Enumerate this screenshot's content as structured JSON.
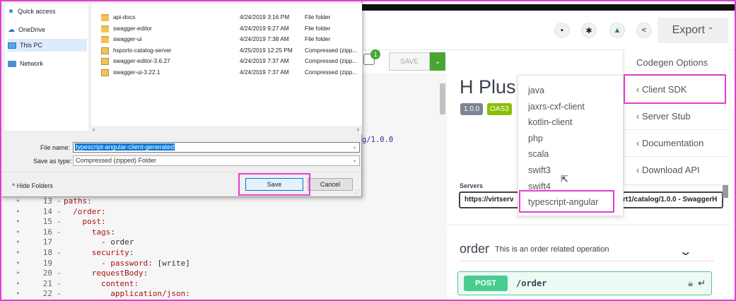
{
  "header": {
    "export_label": "Export",
    "icons": [
      "file-icon",
      "gear-icon",
      "bell-icon",
      "share-icon"
    ]
  },
  "editor": {
    "save_label": "SAVE",
    "notification_count": "1",
    "version_fragment": "g/1.0.0",
    "lines": [
      {
        "num": "13",
        "fold": "-",
        "key": "paths:",
        "rest": ""
      },
      {
        "num": "14",
        "fold": "-",
        "key": "  /order:",
        "rest": ""
      },
      {
        "num": "15",
        "fold": "-",
        "key": "    post:",
        "rest": ""
      },
      {
        "num": "16",
        "fold": "-",
        "key": "      tags:",
        "rest": ""
      },
      {
        "num": "17",
        "fold": "",
        "key": "",
        "rest": "        - order"
      },
      {
        "num": "18",
        "fold": "-",
        "key": "      security:",
        "rest": ""
      },
      {
        "num": "19",
        "fold": "",
        "key": "        - password:",
        "rest": " [write]"
      },
      {
        "num": "20",
        "fold": "-",
        "key": "      requestBody:",
        "rest": ""
      },
      {
        "num": "21",
        "fold": "-",
        "key": "        content:",
        "rest": ""
      },
      {
        "num": "22",
        "fold": "-",
        "key": "          application/json:",
        "rest": ""
      }
    ]
  },
  "api": {
    "title": "H Plus",
    "version": "1.0.0",
    "oas": "OAS3",
    "servers_label": "Servers",
    "server_url_prefix": "https://virtserv",
    "server_url_suffix": "rt1/catalog/1.0.0 - SwaggerH",
    "tag_name": "order",
    "tag_description": "This is an order related operation",
    "op_method": "POST",
    "op_path": "/order"
  },
  "export_menu": {
    "items": [
      "Codegen Options",
      "‹ Client SDK",
      "‹ Server Stub",
      "‹ Documentation",
      "‹ Download API"
    ]
  },
  "language_menu": {
    "items": [
      "java",
      "jaxrs-cxf-client",
      "kotlin-client",
      "php",
      "scala",
      "swift3",
      "swift4",
      "typescript-angular"
    ]
  },
  "dialog": {
    "nav": [
      {
        "label": "Quick access",
        "icon": "star-icon"
      },
      {
        "label": "OneDrive",
        "icon": "cloud-icon"
      },
      {
        "label": "This PC",
        "icon": "monitor-icon"
      },
      {
        "label": "Network",
        "icon": "network-icon"
      }
    ],
    "files": [
      {
        "name": "api-docs",
        "date": "4/24/2019 3:16 PM",
        "type": "File folder",
        "kind": "folder"
      },
      {
        "name": "swagger-editor",
        "date": "4/24/2019 9:27 AM",
        "type": "File folder",
        "kind": "folder"
      },
      {
        "name": "swagger-ui",
        "date": "4/24/2019 7:38 AM",
        "type": "File folder",
        "kind": "folder"
      },
      {
        "name": "hsports-catalog-server",
        "date": "4/25/2019 12:25 PM",
        "type": "Compressed (zipp...",
        "kind": "zip"
      },
      {
        "name": "swagger-editor-3.6.27",
        "date": "4/24/2019 7:37 AM",
        "type": "Compressed (zipp...",
        "kind": "zip"
      },
      {
        "name": "swagger-ui-3.22.1",
        "date": "4/24/2019 7:37 AM",
        "type": "Compressed (zipp...",
        "kind": "zip"
      }
    ],
    "file_name_label": "File name:",
    "file_name_value": "typescript-angular-client-generated",
    "save_type_label": "Save as type:",
    "save_type_value": "Compressed (zipped) Folder",
    "hide_folders": "Hide Folders",
    "save_button": "Save",
    "cancel_button": "Cancel"
  }
}
